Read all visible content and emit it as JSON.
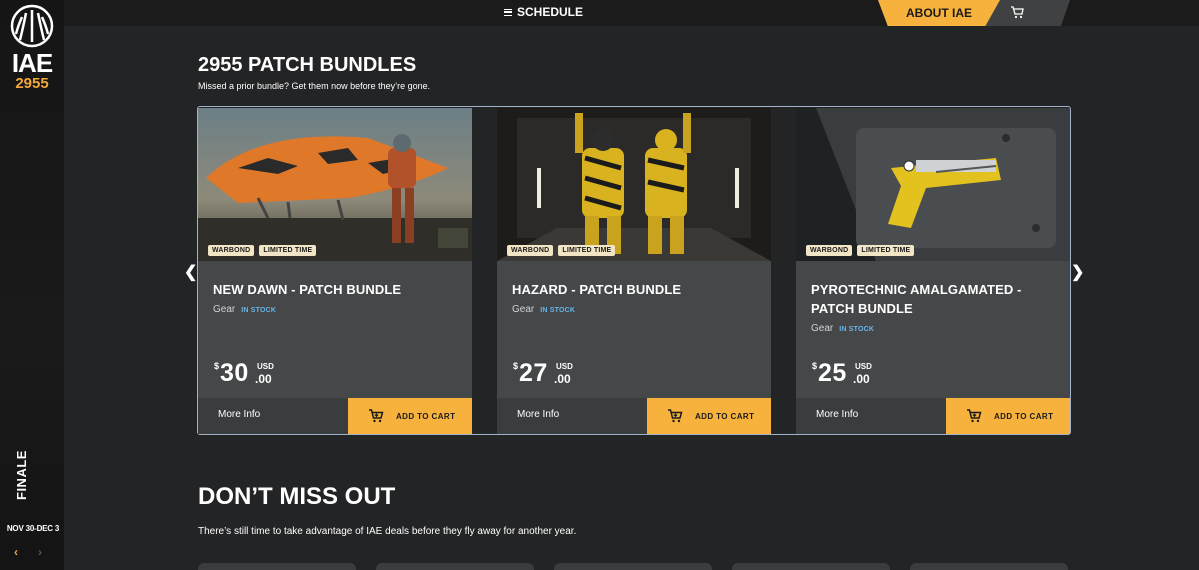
{
  "sidebar": {
    "logo_text": "IAE",
    "logo_year": "2955",
    "event_label": "FINALE",
    "dates": "NOV 30-DEC 3",
    "prev_icon": "chevron-left-icon",
    "next_icon": "chevron-right-icon"
  },
  "topbar": {
    "schedule_label": "SCHEDULE",
    "about_label": "ABOUT IAE",
    "cart_icon": "cart-icon"
  },
  "section": {
    "title": "2955 PATCH BUNDLES",
    "subtitle": "Missed a prior bundle? Get them now before they’re gone."
  },
  "cards": [
    {
      "badges": [
        "WARBOND",
        "LIMITED TIME"
      ],
      "name": "NEW DAWN - PATCH BUNDLE",
      "type": "Gear",
      "stock": "IN STOCK",
      "currency_symbol": "$",
      "price_whole": "30",
      "currency_code": "USD",
      "price_cents": ".00",
      "more_info": "More Info",
      "add_to_cart": "ADD TO CART"
    },
    {
      "badges": [
        "WARBOND",
        "LIMITED TIME"
      ],
      "name": "HAZARD - PATCH BUNDLE",
      "type": "Gear",
      "stock": "IN STOCK",
      "currency_symbol": "$",
      "price_whole": "27",
      "currency_code": "USD",
      "price_cents": ".00",
      "more_info": "More Info",
      "add_to_cart": "ADD TO CART"
    },
    {
      "badges": [
        "WARBOND",
        "LIMITED TIME"
      ],
      "name": "PYROTECHNIC AMALGAMATED - PATCH BUNDLE",
      "type": "Gear",
      "stock": "IN STOCK",
      "currency_symbol": "$",
      "price_whole": "25",
      "currency_code": "USD",
      "price_cents": ".00",
      "more_info": "More Info",
      "add_to_cart": "ADD TO CART"
    }
  ],
  "dont_miss": {
    "title": "DON’T MISS OUT",
    "subtitle": "There’s still time to take advantage of IAE deals before they fly away for another year."
  },
  "colors": {
    "accent": "#f6b23c",
    "stock": "#67b6e8",
    "background": "#232425"
  }
}
